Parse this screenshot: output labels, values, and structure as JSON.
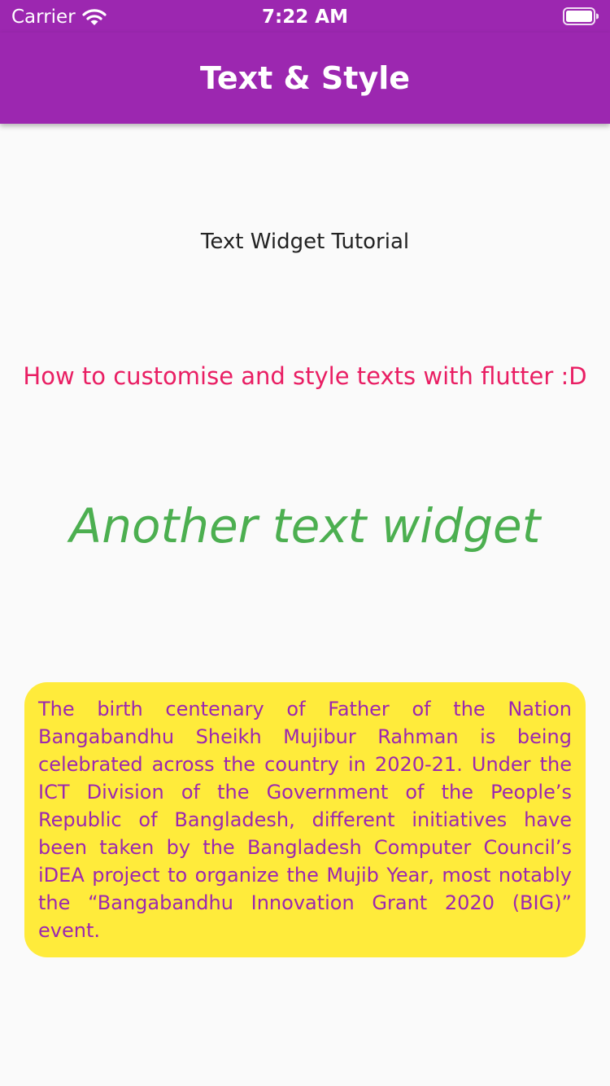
{
  "status_bar": {
    "carrier": "Carrier",
    "time": "7:22 AM",
    "wifi_icon": "wifi-icon",
    "battery_icon": "battery-icon"
  },
  "app_bar": {
    "title": "Text & Style",
    "background_color": "#9c27b0"
  },
  "content": {
    "tutorial_title": "Text Widget Tutorial",
    "subtitle": "How to customise and style texts with flutter :D",
    "subtitle_color": "#e91e63",
    "another_text": "Another text widget",
    "another_text_color": "#4caf50",
    "info_card": {
      "text": "The birth centenary of Father of the Nation Bangabandhu Sheikh Mujibur Rahman is being celebrated across the country in 2020-21. Under the ICT Division of the Government of the People’s Republic of Bangladesh, different initiatives have been taken by the Bangladesh Computer Council’s iDEA project to organize the Mujib Year, most notably the “Bangabandhu Innovation Grant 2020 (BIG)” event.",
      "background_color": "#ffeb3b",
      "text_color": "#9c27b0"
    }
  }
}
